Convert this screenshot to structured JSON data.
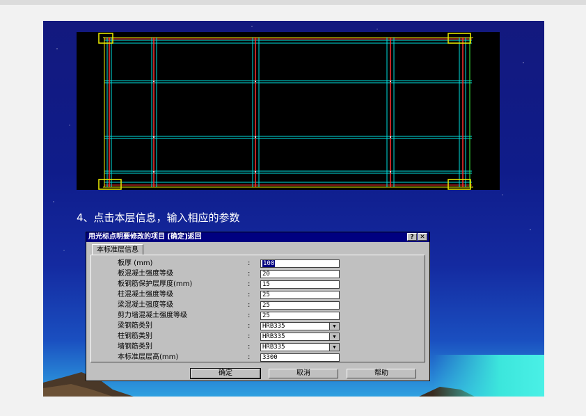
{
  "caption": "4、点击本层信息，输入相应的参数",
  "dialog": {
    "title": "用光标点明要修改的项目 [确定]返回",
    "help_btn": "?",
    "close_btn": "✕",
    "tab": "本标准层信息",
    "fields": [
      {
        "label": "板厚  (mm)",
        "value": "100",
        "type": "input"
      },
      {
        "label": "板混凝土强度等级",
        "value": "20",
        "type": "input"
      },
      {
        "label": "板钢筋保护层厚度(mm)",
        "value": "15",
        "type": "input"
      },
      {
        "label": "柱混凝土强度等级",
        "value": "25",
        "type": "input"
      },
      {
        "label": "梁混凝土强度等级",
        "value": "25",
        "type": "input"
      },
      {
        "label": "剪力墙混凝土强度等级",
        "value": "25",
        "type": "input"
      },
      {
        "label": "梁钢筋类别",
        "value": "HRB335",
        "type": "select"
      },
      {
        "label": "柱钢筋类别",
        "value": "HRB335",
        "type": "select"
      },
      {
        "label": "墙钢筋类别",
        "value": "HRB335",
        "type": "select"
      },
      {
        "label": "本标准层层高(mm)",
        "value": "3300",
        "type": "input"
      }
    ],
    "colon": ":",
    "buttons": {
      "ok": "确定",
      "cancel": "取消",
      "help": "帮助"
    }
  },
  "colors": {
    "titlebar": "#000080",
    "dialog_bg": "#c0c0c0",
    "cad_bg": "#000000"
  }
}
